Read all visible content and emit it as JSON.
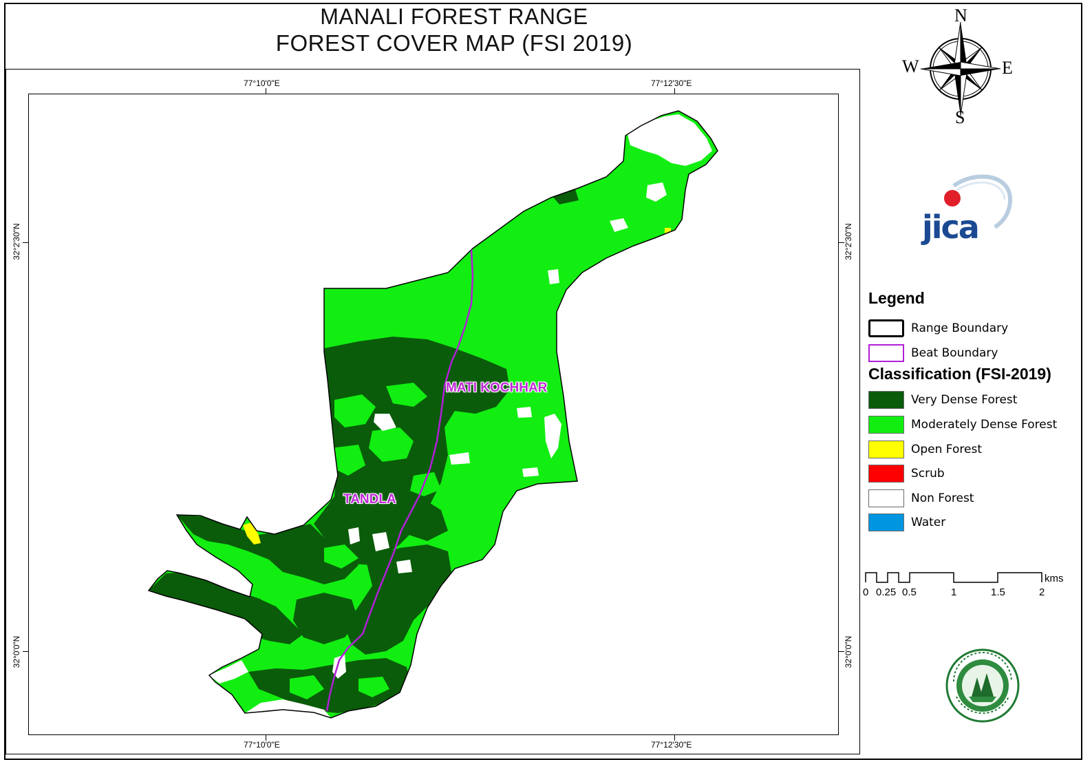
{
  "title": {
    "line1": "MANALI FOREST RANGE",
    "line2": "FOREST COVER MAP (FSI 2019)"
  },
  "graticule": {
    "top_left": "77°10'0\"E",
    "top_right": "77°12'30\"E",
    "bottom_left": "77°10'0\"E",
    "bottom_right": "77°12'30\"E",
    "left_upper": "32°2'30\"N",
    "left_lower": "32°0'0\"N",
    "right_upper": "32°2'30\"N",
    "right_lower": "32°0'0\"N"
  },
  "beats": {
    "north": "MATI KOCHHAR",
    "south": "TANDLA"
  },
  "compass": {
    "n": "N",
    "s": "S",
    "e": "E",
    "w": "W"
  },
  "logos": {
    "jica_text": "JICA",
    "department_seal": "forest-department-seal"
  },
  "legend": {
    "title": "Legend",
    "boundaries": [
      {
        "label": "Range Boundary",
        "stroke": "#000000"
      },
      {
        "label": "Beat Boundary",
        "stroke": "#b21ed8"
      }
    ],
    "classification_title": "Classification (FSI-2019)",
    "classes": [
      {
        "label": "Very Dense Forest",
        "color": "#0a5c0a"
      },
      {
        "label": "Moderately Dense Forest",
        "color": "#12ee12"
      },
      {
        "label": "Open Forest",
        "color": "#ffff00"
      },
      {
        "label": "Scrub",
        "color": "#ff0000"
      },
      {
        "label": "Non Forest",
        "color": "#ffffff"
      },
      {
        "label": "Water",
        "color": "#0095e0"
      }
    ]
  },
  "scalebar": {
    "unit": "kms",
    "ticks": [
      "0",
      "0.25",
      "0.5",
      "1",
      "1.5",
      "2"
    ]
  }
}
